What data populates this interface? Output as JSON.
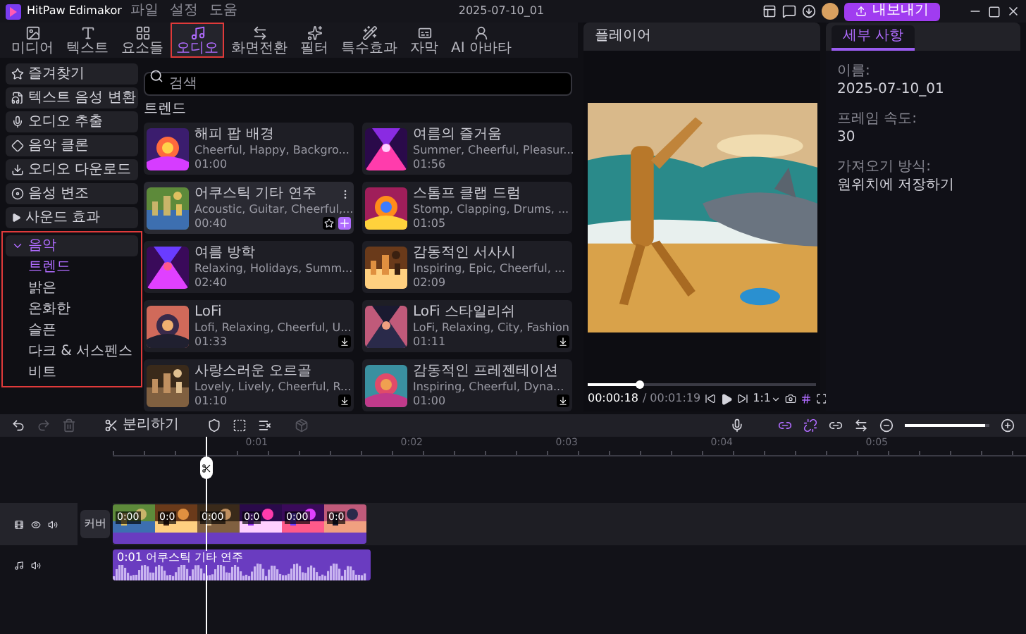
{
  "app": {
    "name": "HitPaw Edimakor",
    "menus": [
      "파일",
      "설정",
      "도움"
    ],
    "project_date": "2025-07-10_01",
    "export_label": "내보내기"
  },
  "toolbar_tabs": [
    {
      "label": "미디어",
      "selected": false,
      "highlighted": false
    },
    {
      "label": "텍스트",
      "selected": false,
      "highlighted": false
    },
    {
      "label": "요소들",
      "selected": false,
      "highlighted": false
    },
    {
      "label": "오디오",
      "selected": true,
      "highlighted": true
    },
    {
      "label": "화면전환",
      "selected": false,
      "highlighted": false
    },
    {
      "label": "필터",
      "selected": false,
      "highlighted": false
    },
    {
      "label": "특수효과",
      "selected": false,
      "highlighted": false
    },
    {
      "label": "자막",
      "selected": false,
      "highlighted": false
    },
    {
      "label": "AI 아바타",
      "selected": false,
      "highlighted": false
    }
  ],
  "sidebar": {
    "items": [
      {
        "label": "즐겨찾기",
        "kind": "item"
      },
      {
        "label": "텍스트 음성 변환",
        "kind": "item"
      },
      {
        "label": "오디오 추출",
        "kind": "item"
      },
      {
        "label": "음악 클론",
        "kind": "item"
      },
      {
        "label": "오디오 다운로드",
        "kind": "item"
      },
      {
        "label": "음성 변조",
        "kind": "item"
      },
      {
        "label": "사운드 효과",
        "kind": "group",
        "expanded": false,
        "highlighted": false
      },
      {
        "label": "음악",
        "kind": "group",
        "expanded": true,
        "highlighted": true,
        "children": [
          {
            "label": "트렌드",
            "selected": true
          },
          {
            "label": "밝은",
            "selected": false
          },
          {
            "label": "온화한",
            "selected": false
          },
          {
            "label": "슬픈",
            "selected": false
          },
          {
            "label": "다크 & 서스펜스",
            "selected": false
          },
          {
            "label": "비트",
            "selected": false
          }
        ]
      }
    ]
  },
  "search": {
    "placeholder": "검색"
  },
  "section_title": "트렌드",
  "tracks": [
    {
      "title": "해피 팝 배경",
      "tags": "Cheerful, Happy, Backgro...",
      "duration": "01:00",
      "hovered": false,
      "downloadable": false
    },
    {
      "title": "여름의 즐거움",
      "tags": "Summer, Cheerful, Pleasur...",
      "duration": "01:56",
      "hovered": false,
      "downloadable": false
    },
    {
      "title": "어쿠스틱 기타 연주",
      "tags": "Acoustic, Guitar, Cheerful,...",
      "duration": "00:40",
      "hovered": true,
      "downloadable": false
    },
    {
      "title": "스톰프 클랩 드럼",
      "tags": "Stomp, Clapping, Drums, ...",
      "duration": "01:05",
      "hovered": false,
      "downloadable": false
    },
    {
      "title": "여름 방학",
      "tags": "Relaxing, Holidays, Summ...",
      "duration": "02:40",
      "hovered": false,
      "downloadable": false
    },
    {
      "title": "감동적인 서사시",
      "tags": "Inspiring, Epic, Cheerful, ...",
      "duration": "02:09",
      "hovered": false,
      "downloadable": false
    },
    {
      "title": "LoFi",
      "tags": "Lofi, Relaxing, Cheerful, U...",
      "duration": "01:33",
      "hovered": false,
      "downloadable": true
    },
    {
      "title": "LoFi 스타일리쉬",
      "tags": "LoFi, Relaxing, City, Fashion",
      "duration": "01:11",
      "hovered": false,
      "downloadable": true
    },
    {
      "title": "사랑스러운 오르골",
      "tags": "Lovely, Lively, Cheerful, R...",
      "duration": "01:10",
      "hovered": false,
      "downloadable": true
    },
    {
      "title": "감동적인 프레젠테이션",
      "tags": "Inspiring, Cheerful, Dyna...",
      "duration": "01:00",
      "hovered": false,
      "downloadable": true
    }
  ],
  "player": {
    "title": "플레이어",
    "current_time": "00:00:18",
    "total_time": "/ 00:01:19",
    "level": 0.23,
    "ratio": "1:1"
  },
  "details": {
    "tabs": [
      {
        "label": "세부 사항",
        "selected": true
      }
    ],
    "fields": [
      {
        "label": "이름:",
        "value": "2025-07-10_01"
      },
      {
        "label": "프레임 속도:",
        "value": "30"
      },
      {
        "label": "가져오기 방식:",
        "value": "원위치에 저장하기"
      }
    ]
  },
  "timeline": {
    "split_label": "분리하기",
    "zoom": {
      "level": 0.95
    },
    "ruler": [
      "0:01",
      "0:02",
      "0:03",
      "0:04",
      "0:05"
    ],
    "cover_label": "커버",
    "video_segments": [
      "0:00",
      "0:0",
      "0:00",
      "0:0",
      "0:00",
      "0:0"
    ],
    "audio_clip": {
      "label": "0:01 어쿠스틱 기타 연주"
    }
  }
}
